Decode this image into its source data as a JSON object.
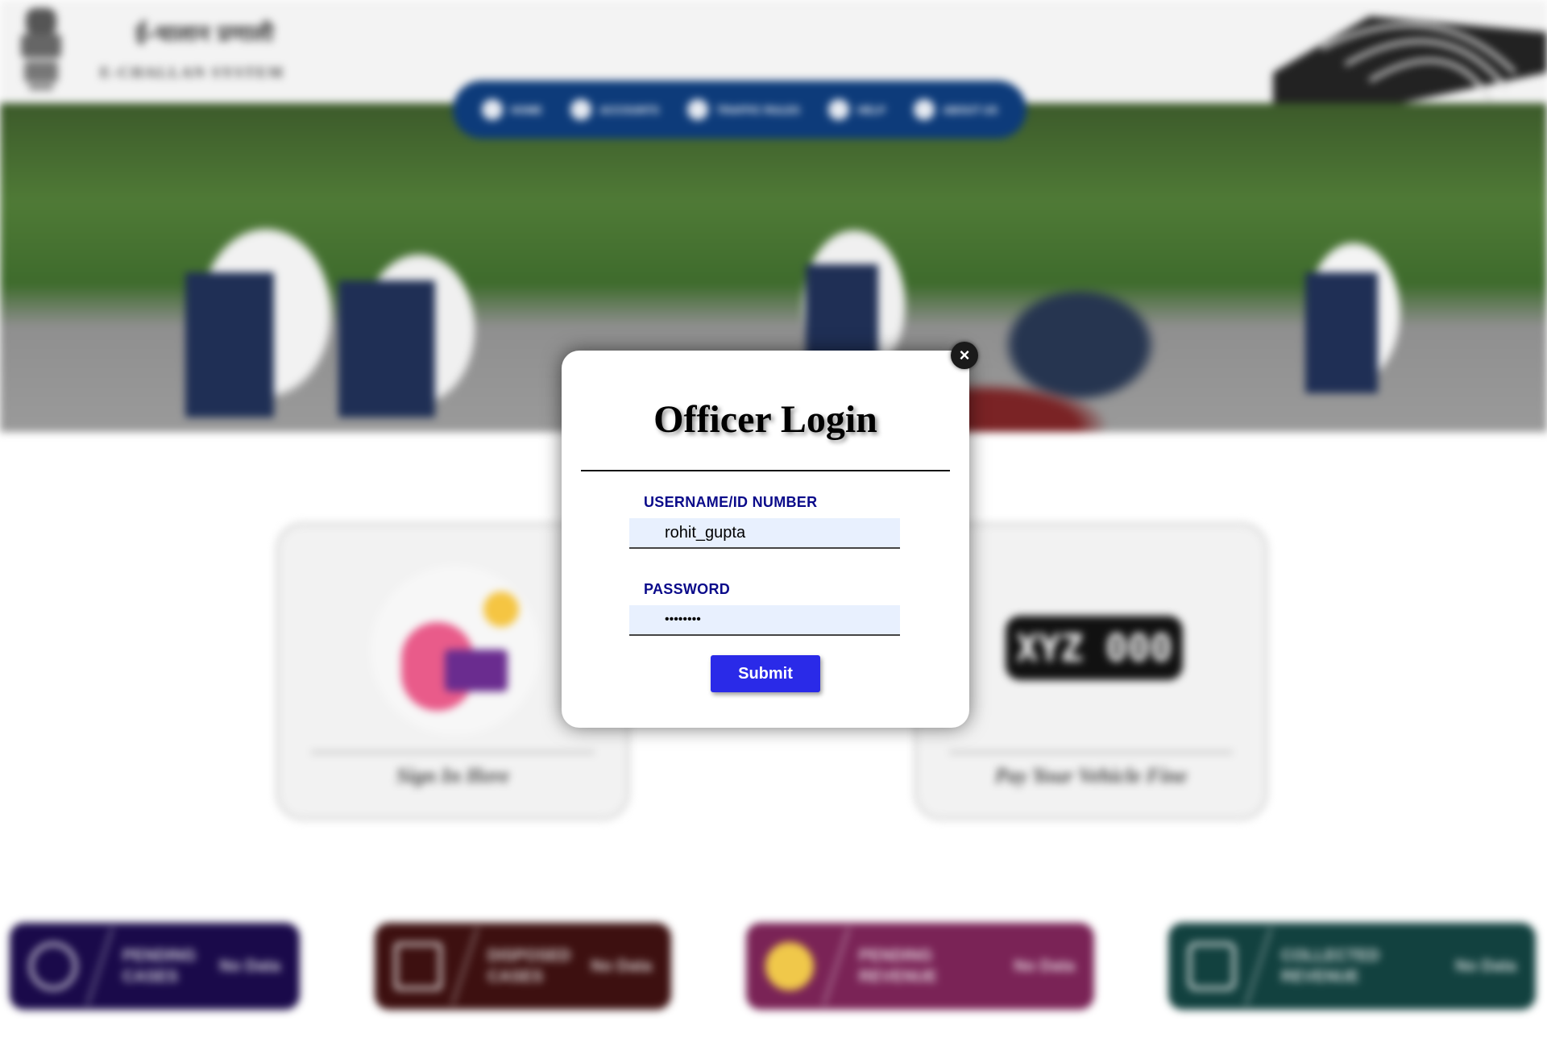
{
  "header": {
    "brand_hindi": "ई-चालान प्रणाली",
    "brand_english": "E-CHALLAN SYSTEM"
  },
  "nav": {
    "items": [
      {
        "label": "HOME",
        "icon": "home-icon"
      },
      {
        "label": "ACCOUNTS",
        "icon": "user-icon"
      },
      {
        "label": "TRAFFIC RULES",
        "icon": "document-icon"
      },
      {
        "label": "HELP",
        "icon": "help-icon"
      },
      {
        "label": "ABOUT US",
        "icon": "info-icon"
      }
    ]
  },
  "cards": {
    "signin_caption": "Sign In Here",
    "pay_caption": "Pay Your Vehicle Fine",
    "plate_text": "XYZ 000"
  },
  "stats": [
    {
      "label_line1": "PENDING",
      "label_line2": "CASES",
      "value": "No Data",
      "color": "#1a0a4a",
      "icon": "alert-icon"
    },
    {
      "label_line1": "DISPOSED",
      "label_line2": "CASES",
      "value": "No Data",
      "color": "#3d1010",
      "icon": "file-icon"
    },
    {
      "label_line1": "PENDING",
      "label_line2": "REVENUE",
      "value": "No Data",
      "color": "#7a2356",
      "icon": "coin-icon"
    },
    {
      "label_line1": "COLLECTED",
      "label_line2": "REVENUE",
      "value": "No Data",
      "color": "#12413f",
      "icon": "money-icon"
    }
  ],
  "login_modal": {
    "title": "Officer Login",
    "username_label": "USERNAME/ID NUMBER",
    "username_value": "rohit_gupta",
    "password_label": "PASSWORD",
    "password_value": "••••••••",
    "submit_label": "Submit",
    "close_label": "×"
  }
}
